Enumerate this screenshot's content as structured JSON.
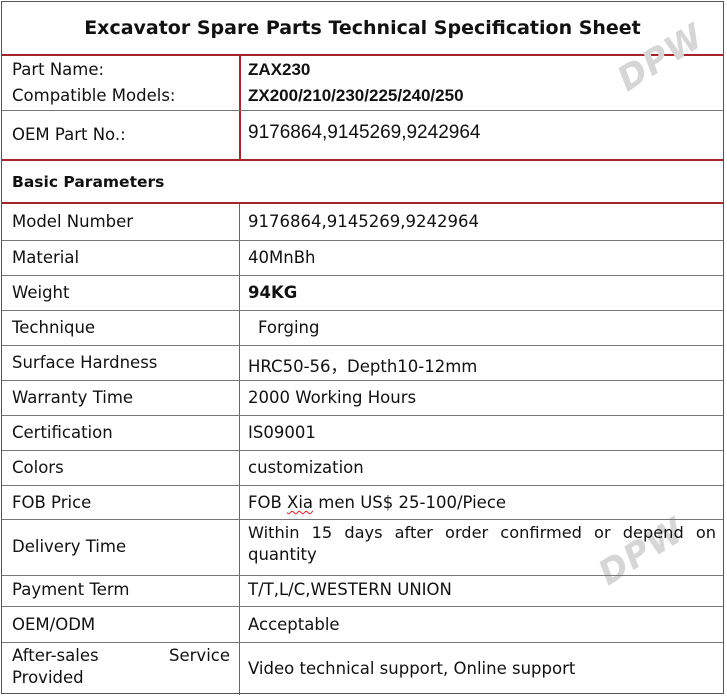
{
  "title": "Excavator Spare Parts Technical Specification Sheet",
  "watermark": "DPW",
  "header": {
    "part_name_label": "Part Name:",
    "part_name_value": "ZAX230",
    "compatible_label": "Compatible Models:",
    "compatible_value": "ZX200/210/230/225/240/250",
    "oem_label": "OEM Part No.:",
    "oem_value": "9176864,9145269,9242964"
  },
  "section_title": "Basic Parameters",
  "params": [
    {
      "label": "Model Number",
      "value": "9176864,9145269,9242964"
    },
    {
      "label": "Material",
      "value": "40MnBh"
    },
    {
      "label": "Weight",
      "value": "94KG"
    },
    {
      "label": "Technique",
      "value": "Forging"
    },
    {
      "label": "Surface Hardness",
      "value": "HRC50-56，Depth10-12mm"
    },
    {
      "label": "Warranty Time",
      "value": "2000 Working Hours"
    },
    {
      "label": "Certification",
      "value": "IS09001"
    },
    {
      "label": "Colors",
      "value": "customization"
    },
    {
      "label": "FOB Price",
      "value_prefix": "FOB ",
      "value_underlined": "Xia",
      "value_suffix": " men US$ 25-100/Piece"
    },
    {
      "label": "Delivery Time",
      "value_line1": "Within  15  days  after  order  confirmed  or  depend  on",
      "value_line2": "quantity"
    },
    {
      "label": "Payment Term",
      "value": "T/T,L/C,WESTERN UNION"
    },
    {
      "label": "OEM/ODM",
      "value": "Acceptable"
    },
    {
      "label_line1_a": "After-sales",
      "label_line1_b": "Service",
      "label_line2": "Provided",
      "value": "Video technical support, Online support"
    }
  ],
  "colors": {
    "accent_red": "#a4262c",
    "watermark": "#d6d6d6"
  }
}
